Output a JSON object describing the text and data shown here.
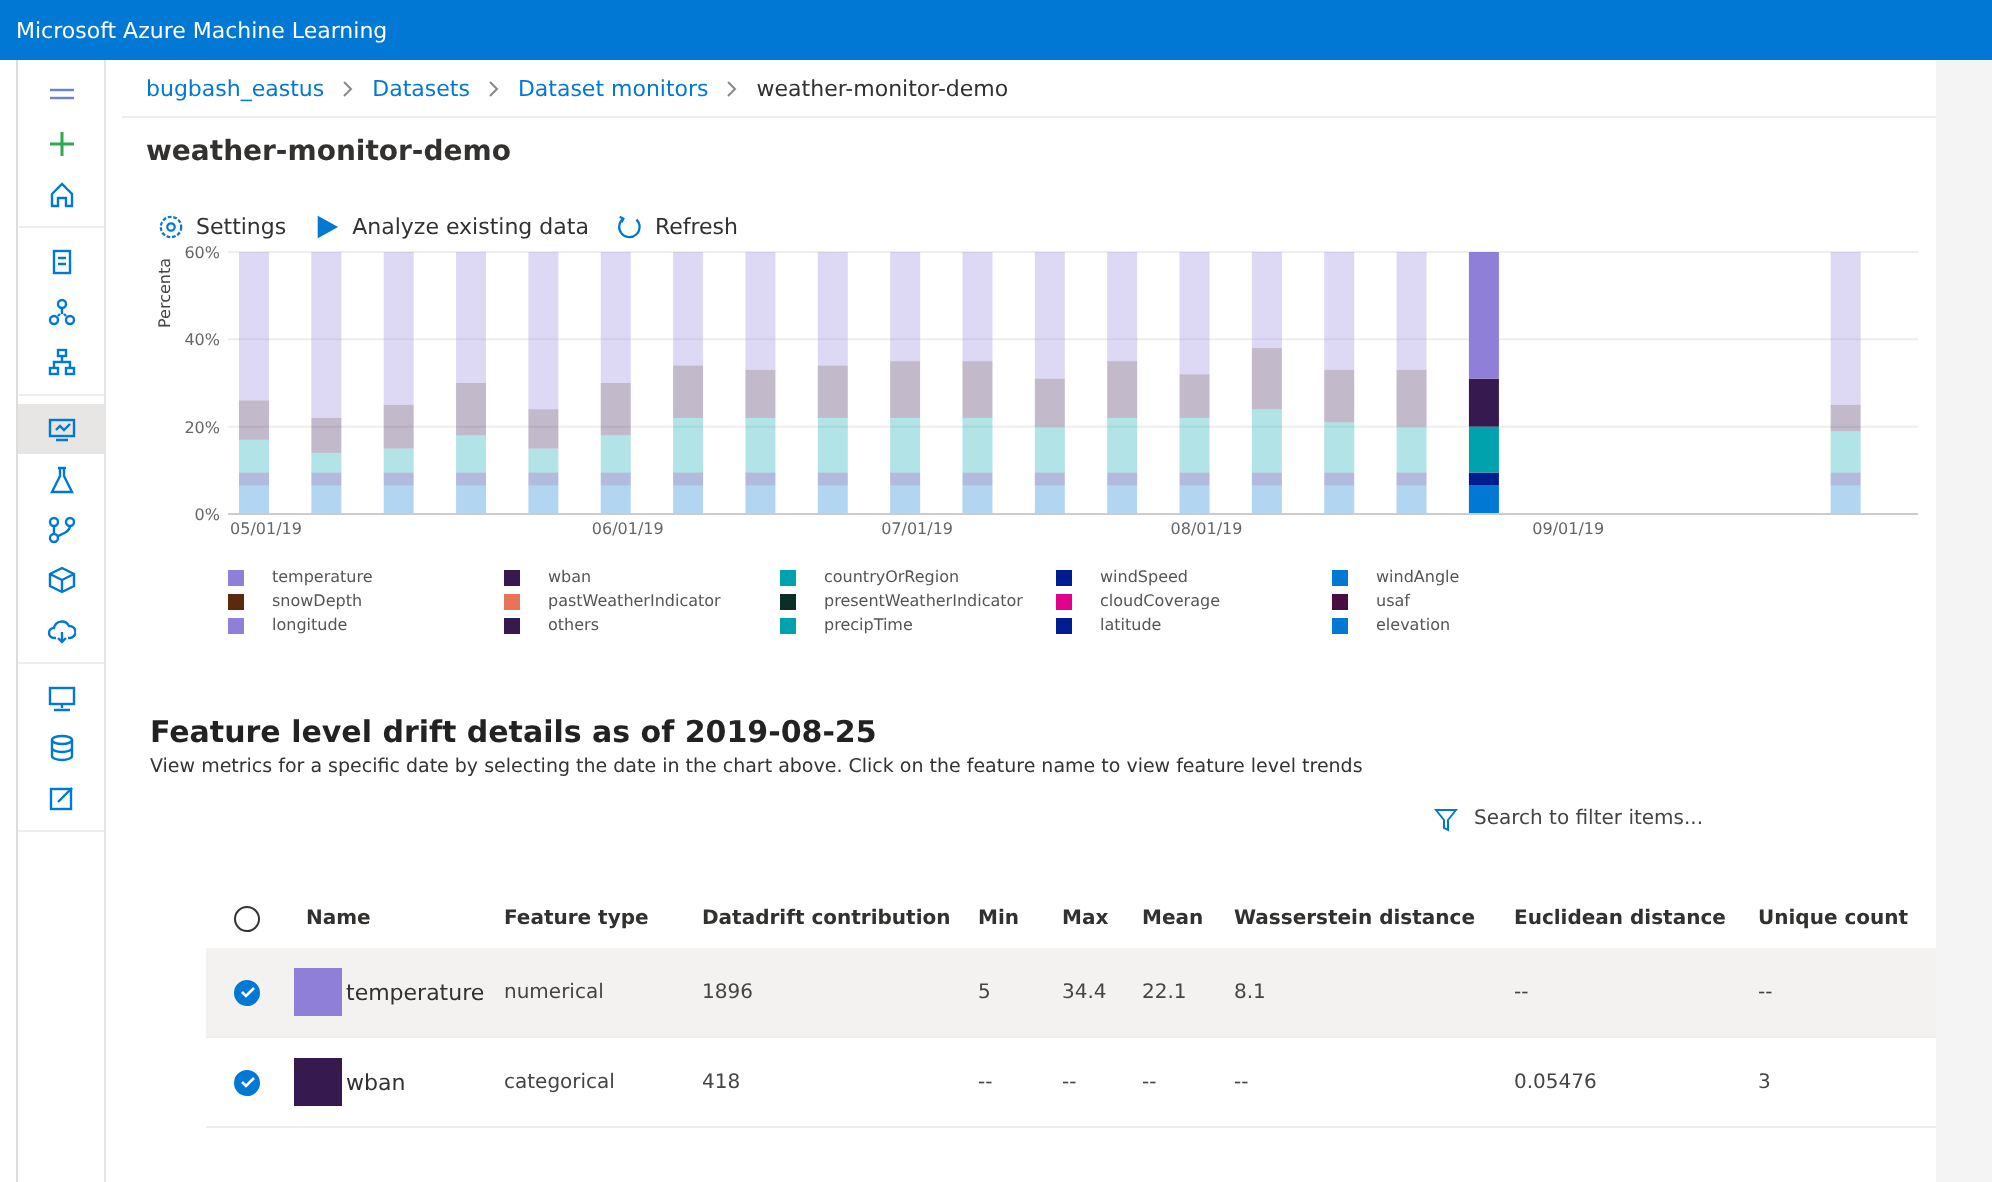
{
  "app_bar": {
    "title": "Microsoft Azure Machine Learning"
  },
  "sidebar": {
    "groups": [
      [
        {
          "kind": "menu",
          "selected": false
        },
        {
          "kind": "add",
          "selected": false
        },
        {
          "kind": "home",
          "selected": false
        }
      ],
      [
        {
          "kind": "notebook",
          "selected": false
        },
        {
          "kind": "flow",
          "selected": false
        },
        {
          "kind": "hierarchy",
          "selected": false
        }
      ],
      [
        {
          "kind": "monitor",
          "selected": true
        },
        {
          "kind": "flask",
          "selected": false
        },
        {
          "kind": "pipeline",
          "selected": false
        },
        {
          "kind": "cube",
          "selected": false
        },
        {
          "kind": "cloud",
          "selected": false
        }
      ],
      [
        {
          "kind": "computer",
          "selected": false
        },
        {
          "kind": "database",
          "selected": false
        },
        {
          "kind": "edit",
          "selected": false
        }
      ]
    ]
  },
  "breadcrumb": [
    {
      "label": "bugbash_eastus",
      "current": false
    },
    {
      "label": "Datasets",
      "current": false
    },
    {
      "label": "Dataset monitors",
      "current": false
    },
    {
      "label": "weather-monitor-demo",
      "current": true
    }
  ],
  "page_title": "weather-monitor-demo",
  "toolbar": [
    {
      "kind": "settings",
      "label": "Settings"
    },
    {
      "kind": "play",
      "label": "Analyze existing data"
    },
    {
      "kind": "refresh",
      "label": "Refresh"
    }
  ],
  "drift_chart": {
    "bar_selected": [
      false,
      false,
      false,
      false,
      false,
      false,
      false,
      false,
      false,
      false,
      false,
      false,
      false,
      false,
      false,
      false,
      false,
      true,
      false
    ],
    "chart_data": {
      "type": "bar",
      "stacked": true,
      "ylabel": "Percenta",
      "categories": [
        "05/01/19",
        null,
        null,
        null,
        null,
        "06/01/19",
        null,
        null,
        null,
        "07/01/19",
        null,
        null,
        null,
        "08/01/19",
        null,
        null,
        null,
        null,
        "09/01/19",
        null,
        null,
        null,
        null
      ],
      "ylim": [
        0,
        60
      ],
      "yticks": [
        {
          "value": 0,
          "label": "0%"
        },
        {
          "value": 20,
          "label": "20%"
        },
        {
          "value": 40,
          "label": "40%"
        },
        {
          "value": 60,
          "label": "60%"
        }
      ],
      "series": [
        {
          "name": "temperature",
          "color": "#8f7fd9",
          "values": [
            0,
            0,
            0,
            0,
            0,
            0,
            0,
            0,
            0,
            0,
            0,
            0,
            0,
            0,
            0,
            0,
            0,
            0,
            null,
            null,
            null,
            null,
            0
          ]
        },
        {
          "name": "wban",
          "color": "#35194f",
          "values": [
            0,
            0,
            0,
            0,
            0,
            0,
            0,
            0,
            0,
            0,
            0,
            0,
            0,
            0,
            0,
            0,
            0,
            0,
            null,
            null,
            null,
            null,
            0
          ]
        },
        {
          "name": "countryOrRegion",
          "color": "#00a2ad",
          "values": [
            0,
            0,
            0,
            0,
            0,
            0,
            0,
            0,
            0,
            0,
            0,
            0,
            0,
            0,
            0,
            0,
            0,
            0,
            null,
            null,
            null,
            null,
            0
          ]
        },
        {
          "name": "windSpeed",
          "color": "#001d8f",
          "values": [
            0,
            0,
            0,
            0,
            0,
            0,
            0,
            0,
            0,
            0,
            0,
            0,
            0,
            0,
            0,
            0,
            0,
            0,
            null,
            null,
            null,
            null,
            0
          ]
        },
        {
          "name": "windAngle",
          "color": "#0078d4",
          "values": [
            0,
            0,
            0,
            0,
            0,
            0,
            0,
            0,
            0,
            0,
            0,
            0,
            0,
            0,
            0,
            0,
            0,
            0,
            null,
            null,
            null,
            null,
            0
          ]
        },
        {
          "name": "snowDepth",
          "color": "#5a2a0c",
          "values": [
            0,
            0,
            0,
            0,
            0,
            0,
            0,
            0,
            0,
            0,
            0,
            0,
            0,
            0,
            0,
            0,
            0,
            0,
            null,
            null,
            null,
            null,
            0
          ]
        },
        {
          "name": "pastWeatherIndicator",
          "color": "#e8735a",
          "values": [
            0,
            0,
            0,
            0,
            0,
            0,
            0,
            0,
            0,
            0,
            0,
            0,
            0,
            0,
            0,
            0,
            0,
            0,
            null,
            null,
            null,
            null,
            0
          ]
        },
        {
          "name": "presentWeatherIndicator",
          "color": "#0b2e27",
          "values": [
            0,
            0,
            0,
            0,
            0,
            0,
            0,
            0,
            0,
            0,
            0,
            0,
            0,
            0,
            0,
            0,
            0,
            0,
            null,
            null,
            null,
            null,
            0
          ]
        },
        {
          "name": "cloudCoverage",
          "color": "#e3008c",
          "values": [
            0,
            0,
            0,
            0,
            0,
            0,
            0,
            0,
            0,
            0,
            0,
            0,
            0,
            0,
            0,
            0,
            0,
            0,
            null,
            null,
            null,
            null,
            0
          ]
        },
        {
          "name": "usaf",
          "color": "#4a0d3f",
          "values": [
            0,
            0,
            0,
            0,
            0,
            0,
            0,
            0,
            0,
            0,
            0,
            0,
            0,
            0,
            0,
            0,
            0,
            0,
            null,
            null,
            null,
            null,
            0
          ]
        },
        {
          "name": "longitude",
          "color": "#8f7fd9",
          "values": [
            34,
            38,
            35,
            30,
            36,
            30,
            26,
            27,
            26,
            25,
            25,
            29,
            25,
            28,
            22,
            27,
            27,
            29,
            null,
            null,
            null,
            null,
            35
          ]
        },
        {
          "name": "others",
          "color": "#35194f",
          "values": [
            9,
            8,
            10,
            12,
            9,
            12,
            12,
            11,
            12,
            13,
            13,
            11,
            13,
            10,
            14,
            12,
            13,
            11,
            null,
            null,
            null,
            null,
            6
          ]
        },
        {
          "name": "precipTime",
          "color": "#00a2ad",
          "values": [
            7.5,
            4.5,
            5.5,
            8.5,
            5.5,
            8.5,
            12.5,
            12.5,
            12.5,
            12.5,
            12.5,
            10.5,
            12.5,
            12.5,
            14.5,
            11.5,
            10.5,
            10.5,
            null,
            null,
            null,
            null,
            9.5
          ]
        },
        {
          "name": "latitude",
          "color": "#001d8f",
          "values": [
            3,
            3,
            3,
            3,
            3,
            3,
            3,
            3,
            3,
            3,
            3,
            3,
            3,
            3,
            3,
            3,
            3,
            3,
            null,
            null,
            null,
            null,
            3
          ]
        },
        {
          "name": "elevation",
          "color": "#0078d4",
          "values": [
            6.5,
            6.5,
            6.5,
            6.5,
            6.5,
            6.5,
            6.5,
            6.5,
            6.5,
            6.5,
            6.5,
            6.5,
            6.5,
            6.5,
            6.5,
            6.5,
            6.5,
            6.5,
            null,
            null,
            null,
            null,
            6.5
          ]
        }
      ]
    }
  },
  "details": {
    "heading": "Feature level drift details as of 2019-08-25",
    "description": "View metrics for a specific date by selecting the date in the chart above. Click on the feature name to view feature level trends",
    "search": {
      "placeholder": "Search to filter items..."
    },
    "select_all": {
      "checked": false
    },
    "columns": [
      "Name",
      "Feature type",
      "Datadrift contribution",
      "Min",
      "Max",
      "Mean",
      "Wasserstein distance",
      "Euclidean distance",
      "Unique count"
    ],
    "rows": [
      {
        "checked": true,
        "highlighted": true,
        "color": "#8f7fd9",
        "cells": [
          "temperature",
          "numerical",
          "1896",
          "5",
          "34.4",
          "22.1",
          "8.1",
          "--",
          "--"
        ]
      },
      {
        "checked": true,
        "highlighted": false,
        "color": "#35194f",
        "cells": [
          "wban",
          "categorical",
          "418",
          "--",
          "--",
          "--",
          "--",
          "0.05476",
          "3"
        ]
      }
    ]
  }
}
